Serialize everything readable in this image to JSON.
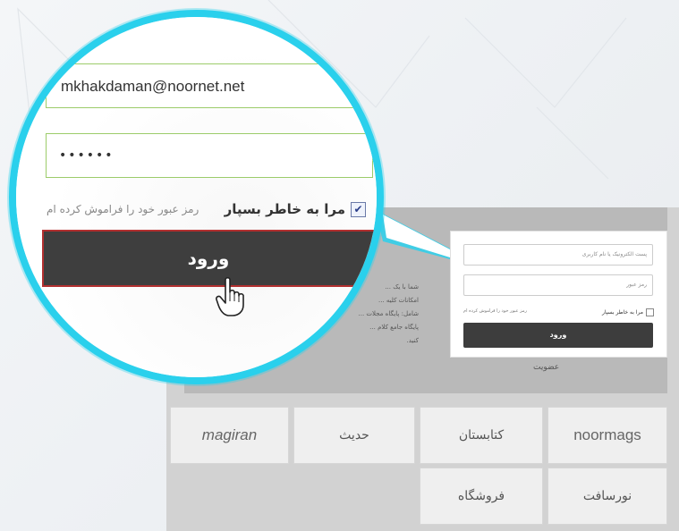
{
  "magnified_form": {
    "email_value": "mkhakdaman@noornet.net",
    "password_value": "••••••",
    "remember_label": "مرا به خاطر بسپار",
    "remember_checked": true,
    "forgot_label": "رمز عبور خود را فراموش کرده ام",
    "login_label": "ورود"
  },
  "mini_form": {
    "email_placeholder": "پست الکترونیک یا نام کاربری",
    "password_placeholder": "رمز عبور",
    "remember_label": "مرا به خاطر بسپار",
    "forgot_label": "رمز عبور خود را فراموش کرده ام",
    "login_label": "ورود"
  },
  "about": {
    "lines": [
      "شما با یک ...",
      "امکانات کلیه ...",
      "شامل: پایگاه مجلات ...",
      "پایگاه جامع کلام ...",
      "کنید."
    ]
  },
  "membership_label": "عضویت",
  "tiles": [
    {
      "name": "noormags",
      "label": "noormags"
    },
    {
      "name": "ketabnak",
      "label": "کتابستان"
    },
    {
      "name": "hadith",
      "label": "حدیث"
    },
    {
      "name": "magiran",
      "label": "magiran"
    },
    {
      "name": "noorsoft",
      "label": "نورسافت"
    },
    {
      "name": "store",
      "label": "فروشگاه"
    }
  ],
  "colors": {
    "ring": "#2ad0ec",
    "button": "#3e3e3e",
    "button_border": "#b23030",
    "field_border": "#9ccc6a"
  }
}
